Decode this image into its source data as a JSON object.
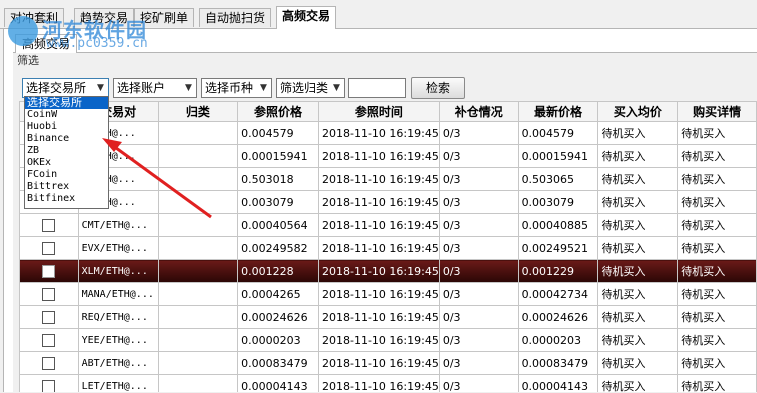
{
  "tabs": [
    "对冲套利",
    "趋势交易",
    "挖矿刷单",
    "自动抛扫货",
    "高频交易"
  ],
  "active_tab": "高频交易",
  "inner_tab": "高频交易",
  "inner_sub": "筛选",
  "watermark": {
    "title": "河东软件园",
    "url": "www.pc0359.cn"
  },
  "toolbar": {
    "exchange": "选择交易所",
    "account": "选择账户",
    "coin": "选择币种",
    "filter": "筛选归类",
    "search_value": "",
    "search_button": "检索"
  },
  "dropdown": {
    "options": [
      "选择交易所",
      "CoinW",
      "Huobi",
      "Binance",
      "ZB",
      "OKEx",
      "FCoin",
      "Bittrex",
      "Bitfinex"
    ]
  },
  "table": {
    "headers": [
      "",
      "交易对",
      "归类",
      "参照价格",
      "参照时间",
      "补仓情况",
      "最新价格",
      "买入均价",
      "购买详情"
    ],
    "rows": [
      {
        "pair": "…/ETH@...",
        "category": "",
        "ref_price": "0.004579",
        "ref_time": "2018-11-10 16:19:45",
        "fill": "0/3",
        "latest": "0.004579",
        "avg_buy": "待机买入",
        "detail": "待机买入"
      },
      {
        "pair": "…/ETH@...",
        "category": "",
        "ref_price": "0.00015941",
        "ref_time": "2018-11-10 16:19:45",
        "fill": "0/3",
        "latest": "0.00015941",
        "avg_buy": "待机买入",
        "detail": "待机买入"
      },
      {
        "pair": "…/ETH@...",
        "category": "",
        "ref_price": "0.503018",
        "ref_time": "2018-11-10 16:19:45",
        "fill": "0/3",
        "latest": "0.503065",
        "avg_buy": "待机买入",
        "detail": "待机买入"
      },
      {
        "pair": "…/ETH@...",
        "category": "",
        "ref_price": "0.003079",
        "ref_time": "2018-11-10 16:19:45",
        "fill": "0/3",
        "latest": "0.003079",
        "avg_buy": "待机买入",
        "detail": "待机买入"
      },
      {
        "pair": "CMT/ETH@...",
        "category": "",
        "ref_price": "0.00040564",
        "ref_time": "2018-11-10 16:19:45",
        "fill": "0/3",
        "latest": "0.00040885",
        "avg_buy": "待机买入",
        "detail": "待机买入"
      },
      {
        "pair": "EVX/ETH@...",
        "category": "",
        "ref_price": "0.00249582",
        "ref_time": "2018-11-10 16:19:45",
        "fill": "0/3",
        "latest": "0.00249521",
        "avg_buy": "待机买入",
        "detail": "待机买入"
      },
      {
        "pair": "XLM/ETH@...",
        "category": "",
        "ref_price": "0.001228",
        "ref_time": "2018-11-10 16:19:45",
        "fill": "0/3",
        "latest": "0.001229",
        "avg_buy": "待机买入",
        "detail": "待机买入",
        "selected": true
      },
      {
        "pair": "MANA/ETH@...",
        "category": "",
        "ref_price": "0.0004265",
        "ref_time": "2018-11-10 16:19:45",
        "fill": "0/3",
        "latest": "0.00042734",
        "avg_buy": "待机买入",
        "detail": "待机买入"
      },
      {
        "pair": "REQ/ETH@...",
        "category": "",
        "ref_price": "0.00024626",
        "ref_time": "2018-11-10 16:19:45",
        "fill": "0/3",
        "latest": "0.00024626",
        "avg_buy": "待机买入",
        "detail": "待机买入"
      },
      {
        "pair": "YEE/ETH@...",
        "category": "",
        "ref_price": "0.0000203",
        "ref_time": "2018-11-10 16:19:45",
        "fill": "0/3",
        "latest": "0.0000203",
        "avg_buy": "待机买入",
        "detail": "待机买入"
      },
      {
        "pair": "ABT/ETH@...",
        "category": "",
        "ref_price": "0.00083479",
        "ref_time": "2018-11-10 16:19:45",
        "fill": "0/3",
        "latest": "0.00083479",
        "avg_buy": "待机买入",
        "detail": "待机买入"
      },
      {
        "pair": "LET/ETH@...",
        "category": "",
        "ref_price": "0.00004143",
        "ref_time": "2018-11-10 16:19:45",
        "fill": "0/3",
        "latest": "0.00004143",
        "avg_buy": "待机买入",
        "detail": "待机买入"
      }
    ]
  },
  "colors": {
    "accent": "#0a64c8",
    "selected_row": "#5a1412",
    "annotation_arrow": "#e02020"
  }
}
